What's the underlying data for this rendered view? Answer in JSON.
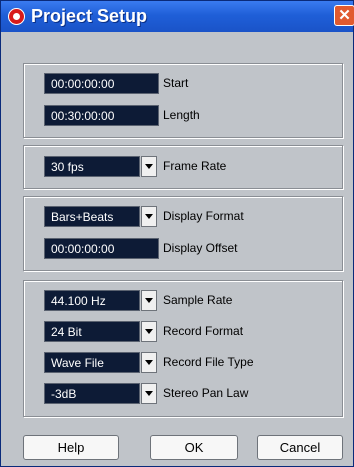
{
  "window": {
    "title": "Project Setup",
    "close_glyph": "✕",
    "app_icon": "cubase-logo-icon"
  },
  "timing": {
    "start": {
      "value": "00:00:00:00",
      "label": "Start"
    },
    "length": {
      "value": "00:30:00:00",
      "label": "Length"
    }
  },
  "frame": {
    "frame_rate": {
      "value": "30 fps",
      "label": "Frame Rate"
    }
  },
  "display": {
    "format": {
      "value": "Bars+Beats",
      "label": "Display Format"
    },
    "offset": {
      "value": "00:00:00:00",
      "label": "Display Offset"
    }
  },
  "audio": {
    "sample_rate": {
      "value": "44.100 Hz",
      "label": "Sample Rate"
    },
    "record_format": {
      "value": "24 Bit",
      "label": "Record Format"
    },
    "record_file_type": {
      "value": "Wave File",
      "label": "Record File Type"
    },
    "stereo_pan_law": {
      "value": "-3dB",
      "label": "Stereo Pan Law"
    }
  },
  "buttons": {
    "help": "Help",
    "ok": "OK",
    "cancel": "Cancel"
  },
  "colors": {
    "titlebar": "#1f5fd8",
    "panel": "#c0c4c9",
    "field_bg": "#0d1b36",
    "close": "#e15a2f"
  }
}
